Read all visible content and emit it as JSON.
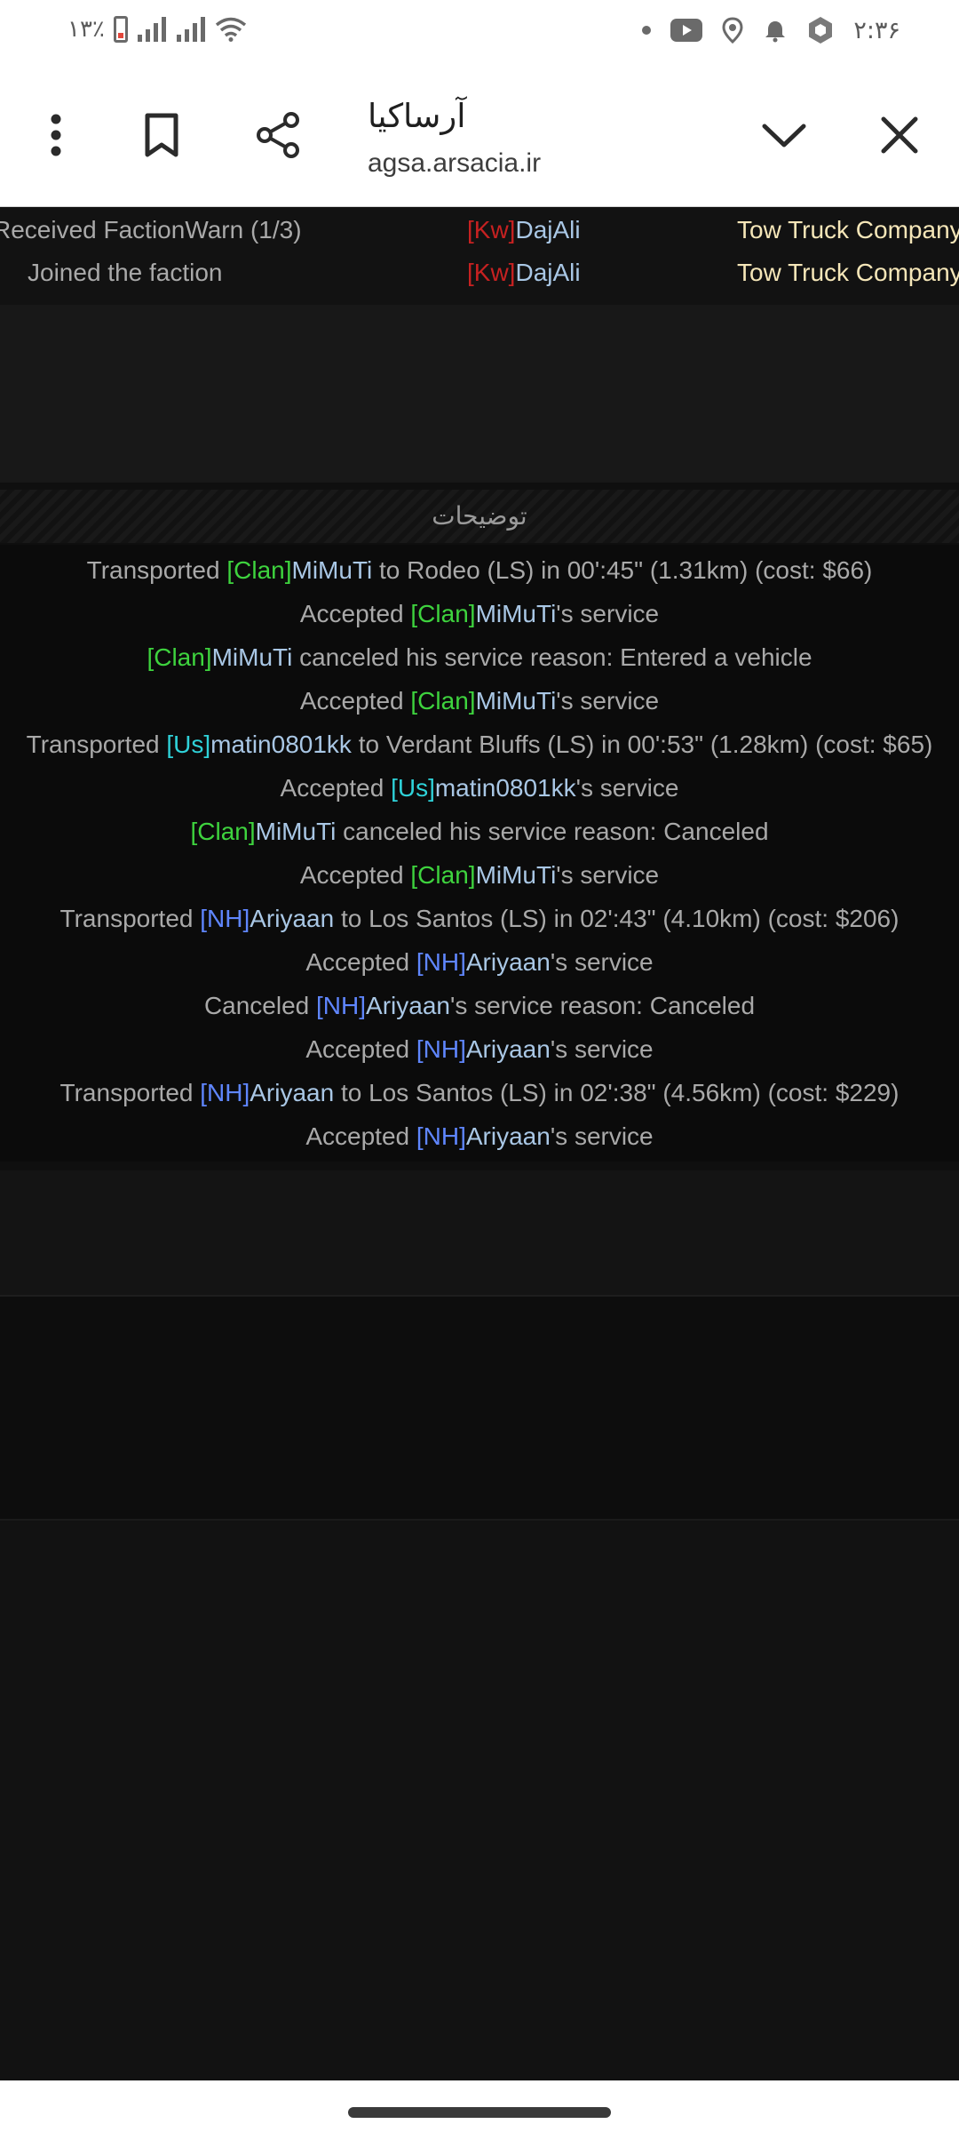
{
  "status_bar": {
    "battery": "۱۳٪",
    "time": "۲:۳۶",
    "icons": [
      "battery-icon",
      "signal-icon",
      "signal-icon",
      "wifi-icon",
      "notification-dot-icon",
      "youtube-icon",
      "location-icon",
      "alarm-icon",
      "vpn-icon"
    ]
  },
  "toolbar": {
    "title": "آرساکیا",
    "url": "agsa.arsacia.ir",
    "icons": [
      "more-vert-icon",
      "bookmark-icon",
      "share-icon",
      "chevron-down-icon",
      "close-icon"
    ]
  },
  "faction_log": [
    {
      "action": "Received FactionWarn (1/3)",
      "tag": "[Kw]",
      "player": "DajAli",
      "faction": "Tow Truck Company"
    },
    {
      "action": "Joined the faction",
      "tag": "[Kw]",
      "player": "DajAli",
      "faction": "Tow Truck Company"
    }
  ],
  "section": {
    "header": "توضیحات"
  },
  "service_log": [
    {
      "before": "Transported ",
      "tag": "[Clan]",
      "name": "MiMuTi",
      "after": " to Rodeo (LS) in 00':45\" (1.31km) (cost: $66)"
    },
    {
      "before": "Accepted ",
      "tag": "[Clan]",
      "name": "MiMuTi",
      "after": "'s service"
    },
    {
      "before": "",
      "tag": "[Clan]",
      "name": "MiMuTi",
      "after": " canceled his service reason: Entered a vehicle"
    },
    {
      "before": "Accepted ",
      "tag": "[Clan]",
      "name": "MiMuTi",
      "after": "'s service"
    },
    {
      "before": "Transported ",
      "tag": "[Us]",
      "name": "matin0801kk",
      "after": " to Verdant Bluffs (LS) in 00':53\" (1.28km) (cost: $65)"
    },
    {
      "before": "Accepted ",
      "tag": "[Us]",
      "name": "matin0801kk",
      "after": "'s service"
    },
    {
      "before": "",
      "tag": "[Clan]",
      "name": "MiMuTi",
      "after": " canceled his service reason: Canceled"
    },
    {
      "before": "Accepted ",
      "tag": "[Clan]",
      "name": "MiMuTi",
      "after": "'s service"
    },
    {
      "before": "Transported ",
      "tag": "[NH]",
      "name": "Ariyaan",
      "after": " to Los Santos (LS) in 02':43\" (4.10km) (cost: $206)"
    },
    {
      "before": "Accepted ",
      "tag": "[NH]",
      "name": "Ariyaan",
      "after": "'s service"
    },
    {
      "before": "Canceled ",
      "tag": "[NH]",
      "name": "Ariyaan",
      "after": "'s service reason: Canceled"
    },
    {
      "before": "Accepted ",
      "tag": "[NH]",
      "name": "Ariyaan",
      "after": "'s service"
    },
    {
      "before": "Transported ",
      "tag": "[NH]",
      "name": "Ariyaan",
      "after": " to Los Santos (LS) in 02':38\" (4.56km) (cost: $229)"
    },
    {
      "before": "Accepted ",
      "tag": "[NH]",
      "name": "Ariyaan",
      "after": "'s service"
    }
  ],
  "colors": {
    "kw_tag": "#c62121",
    "clan_tag": "#3ed33e",
    "us_tag": "#2fd2d9",
    "nh_tag": "#5f86ff",
    "player_name": "#a9c7e5",
    "faction_name": "#f5e6b8",
    "log_text": "#a9a9a9"
  }
}
